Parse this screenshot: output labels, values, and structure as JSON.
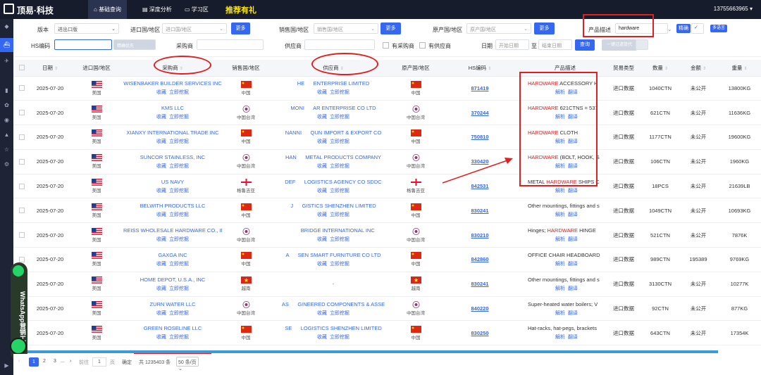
{
  "brand": {
    "name": "顶易·科技"
  },
  "nav": [
    {
      "label": "基础查询",
      "active": true
    },
    {
      "label": "深度分析",
      "active": false
    },
    {
      "label": "学习区",
      "active": false
    },
    {
      "label": "推荐有礼",
      "promo": true
    }
  ],
  "user_phone": "13755663965",
  "filters": {
    "version_label": "版本",
    "version_value": "进出口版",
    "import_label": "进口国/地区",
    "import_placeholder": "进口国/地区",
    "more1": "更多",
    "sales_label": "销售国/地区",
    "sales_placeholder": "销售国/地区",
    "more2": "更多",
    "origin_label": "原产国/地区",
    "origin_placeholder": "原产国/地区",
    "more3": "更多",
    "product_label": "产品描述",
    "product_value": "hardware",
    "exact_btn": "精确",
    "multilang_btn": "多语言",
    "hs_label": "HS编码",
    "exact_first": "精确优先",
    "buyer_label": "采购商",
    "supplier_label": "供应商",
    "has_buyer": "有采购商",
    "has_supplier": "有供应商",
    "date_label": "日期",
    "start_date": "开始日期",
    "to": "至",
    "end_date": "结束日期",
    "search_btn": "查询",
    "filter_btn": "一键过滤货代"
  },
  "table": {
    "headers": [
      "日期",
      "进口国/地区",
      "采购商",
      "销售国/地区",
      "供应商",
      "原产国/地区",
      "HS编码",
      "产品描述",
      "贸易类型",
      "数量",
      "金额",
      "重量"
    ],
    "collect": "收藏",
    "mine": "立即挖掘",
    "analyze": "解析",
    "translate": "翻译",
    "rows": [
      {
        "date": "2025-07-20",
        "imp": "美国",
        "buyer": "WISENBAKER BUILDER SERVICES INC",
        "sell": "中国",
        "supplier": "HE      ENTERPRISE LIMITED",
        "origin": "中国",
        "hs": "871419",
        "desc_hl": "HARDWARE",
        "desc_rest": " ACCESSORY H",
        "trade": "进口数据",
        "qty": "1040CTN",
        "amt": "未公开",
        "wt": "13800KG"
      },
      {
        "date": "2025-07-20",
        "imp": "美国",
        "buyer": "KMS LLC",
        "sell": "中国台湾",
        "supplier": "MONI      AR ENTERPRISE CO LTD",
        "origin": "中国台湾",
        "hs": "370244",
        "desc_hl": "HARDWARE",
        "desc_rest": " 621CTNS = 537",
        "trade": "进口数据",
        "qty": "621CTN",
        "amt": "未公开",
        "wt": "11636KG"
      },
      {
        "date": "2025-07-20",
        "imp": "美国",
        "buyer": "XIANXY INTERNATIONAL TRADE INC",
        "sell": "中国",
        "supplier": "NANNI      QUN IMPORT & EXPORT CO",
        "origin": "中国",
        "hs": "750810",
        "desc_hl": "HARDWARE",
        "desc_rest": " CLOTH",
        "trade": "进口数据",
        "qty": "1177CTN",
        "amt": "未公开",
        "wt": "19600KG"
      },
      {
        "date": "2025-07-20",
        "imp": "美国",
        "buyer": "SUNCOR STAINLESS, INC",
        "sell": "中国台湾",
        "supplier": "HAN      METAL PRODUCTS COMPANY",
        "origin": "中国台湾",
        "hs": "330420",
        "desc_hl": "HARDWARE",
        "desc_rest": " (BOLT, HOOK, S",
        "trade": "进口数据",
        "qty": "106CTN",
        "amt": "未公开",
        "wt": "1960KG"
      },
      {
        "date": "2025-07-20",
        "imp": "美国",
        "buyer": "US NAVY",
        "sell": "格鲁吉亚",
        "supplier": "DEF      LOGISTICS AGENCY CO SDDC",
        "origin": "格鲁吉亚",
        "hs": "842531",
        "desc_pre": "METAL ",
        "desc_hl": "HARDWARE",
        "desc_rest": " SHIPS C",
        "trade": "进口数据",
        "qty": "18PCS",
        "amt": "未公开",
        "wt": "21639LB"
      },
      {
        "date": "2025-07-20",
        "imp": "美国",
        "buyer": "BELWITH PRODUCTS LLC",
        "sell": "中国",
        "supplier": "J      GISTICS SHENZHEN LIMITED",
        "origin": "中国",
        "hs": "830241",
        "desc_pre": "Other mountings, fittings and s",
        "trade": "进口数据",
        "qty": "1049CTN",
        "amt": "未公开",
        "wt": "10693KG"
      },
      {
        "date": "2025-07-20",
        "imp": "美国",
        "buyer": "REISS WHOLESALE HARDWARE CO., INC",
        "sell": "中国台湾",
        "supplier": "      BRIDGE INTERNATIONAL INC",
        "origin": "中国台湾",
        "hs": "830210",
        "desc_pre": "Hinges; ",
        "desc_hl": "HARDWARE",
        "desc_rest": " HINGE",
        "trade": "进口数据",
        "qty": "521CTN",
        "amt": "未公开",
        "wt": "7876K"
      },
      {
        "date": "2025-07-20",
        "imp": "美国",
        "buyer": "GAXGA INC",
        "sell": "中国",
        "supplier": "A      SEN SMART FURNITURE CO LTD",
        "origin": "中国",
        "hs": "842860",
        "desc_pre": "OFFICE CHAIR HEADBOARD",
        "trade": "进口数据",
        "qty": "989CTN",
        "amt": "195389",
        "wt": "9769KG"
      },
      {
        "date": "2025-07-20",
        "imp": "美国",
        "buyer": "HOME DEPOT, U.S.A., INC",
        "sell": "越南",
        "supplier": "-",
        "origin": "越南",
        "hs": "830241",
        "desc_pre": "Other mountings, fittings and s",
        "trade": "进口数据",
        "qty": "3130CTN",
        "amt": "未公开",
        "wt": "10277K"
      },
      {
        "date": "2025-07-20",
        "imp": "美国",
        "buyer": "ZURN WATER LLC",
        "sell": "中国台湾",
        "supplier": "AS      GINEERED COMPONENTS & ASSE",
        "origin": "中国台湾",
        "hs": "840220",
        "desc_pre": "Super-heated water boilers; V",
        "trade": "进口数据",
        "qty": "92CTN",
        "amt": "未公开",
        "wt": "877KG"
      },
      {
        "date": "2025-07-20",
        "imp": "美国",
        "buyer": "GREEN ROSELINE LLC",
        "sell": "中国",
        "supplier": "SE      LOGISTICS SHENZHEN LIMITED",
        "origin": "中国",
        "hs": "830250",
        "desc_pre": "Hat-racks, hat-pegs, brackets",
        "trade": "进口数据",
        "qty": "643CTN",
        "amt": "未公开",
        "wt": "17354K"
      }
    ]
  },
  "footer": {
    "pages": [
      "1",
      "2",
      "3",
      "..."
    ],
    "goto": "前往",
    "page_input": "1",
    "page_unit": "页",
    "confirm": "确定",
    "total": "共 1235403 条",
    "per_page": "50 条/页"
  },
  "whatsapp": "WhatsApp营销工具",
  "colors": {
    "accent": "#3467f2",
    "highlight": "#e02020",
    "topbar": "#171c2c"
  }
}
